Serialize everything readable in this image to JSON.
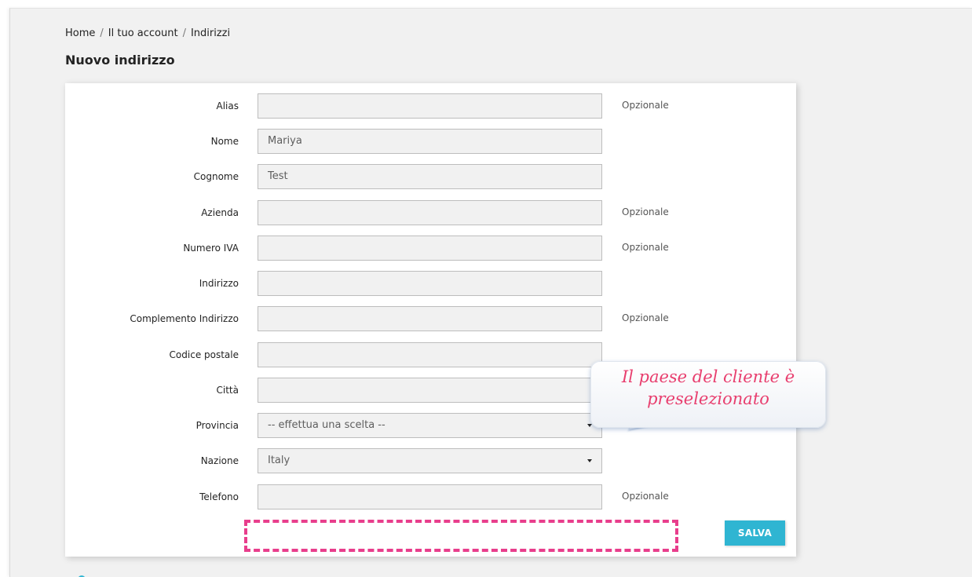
{
  "breadcrumb": {
    "items": [
      "Home",
      "Il tuo account",
      "Indirizzi"
    ],
    "separator": "/"
  },
  "page_title": "Nuovo indirizzo",
  "form": {
    "fields": [
      {
        "label": "Alias",
        "value": "",
        "hint": "Opzionale",
        "type": "text"
      },
      {
        "label": "Nome",
        "value": "Mariya",
        "hint": "",
        "type": "text"
      },
      {
        "label": "Cognome",
        "value": "Test",
        "hint": "",
        "type": "text"
      },
      {
        "label": "Azienda",
        "value": "",
        "hint": "Opzionale",
        "type": "text"
      },
      {
        "label": "Numero IVA",
        "value": "",
        "hint": "Opzionale",
        "type": "text"
      },
      {
        "label": "Indirizzo",
        "value": "",
        "hint": "",
        "type": "text"
      },
      {
        "label": "Complemento Indirizzo",
        "value": "",
        "hint": "Opzionale",
        "type": "text"
      },
      {
        "label": "Codice postale",
        "value": "",
        "hint": "",
        "type": "text"
      },
      {
        "label": "Città",
        "value": "",
        "hint": "",
        "type": "text"
      },
      {
        "label": "Provincia",
        "value": "-- effettua una scelta --",
        "hint": "",
        "type": "select"
      },
      {
        "label": "Nazione",
        "value": "Italy",
        "hint": "",
        "type": "select"
      },
      {
        "label": "Telefono",
        "value": "",
        "hint": "Opzionale",
        "type": "text"
      }
    ],
    "save_label": "SALVA"
  },
  "annotation": {
    "line1": "Il paese del cliente è",
    "line2": "preselezionato"
  },
  "colors": {
    "accent": "#2fb5d2",
    "highlight": "#e83e8c",
    "background": "#f1f1f1"
  }
}
